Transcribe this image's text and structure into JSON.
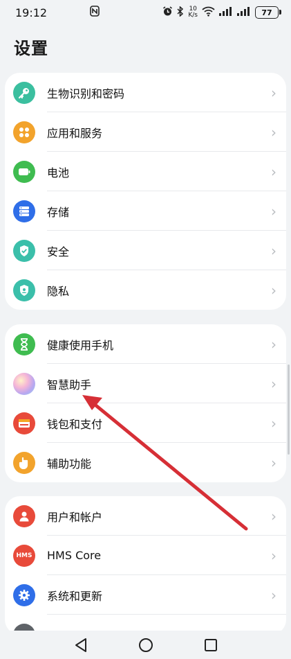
{
  "status_bar": {
    "time": "19:12",
    "speed_value": "10",
    "speed_unit": "K/s",
    "battery": "77"
  },
  "page": {
    "title": "设置"
  },
  "groups": [
    {
      "items": [
        {
          "label": "生物识别和密码",
          "icon": "key-icon",
          "color": "#3bbf9f"
        },
        {
          "label": "应用和服务",
          "icon": "apps-icon",
          "color": "#f2a32c"
        },
        {
          "label": "电池",
          "icon": "battery-icon",
          "color": "#3fbc50"
        },
        {
          "label": "存储",
          "icon": "storage-icon",
          "color": "#2f6ee8"
        },
        {
          "label": "安全",
          "icon": "shield-check-icon",
          "color": "#3bbfaa"
        },
        {
          "label": "隐私",
          "icon": "privacy-shield-icon",
          "color": "#3bbfaa"
        }
      ]
    },
    {
      "items": [
        {
          "label": "健康使用手机",
          "icon": "hourglass-icon",
          "color": "#3fbc50"
        },
        {
          "label": "智慧助手",
          "icon": "assistant-orb-icon",
          "color": "#c99be6"
        },
        {
          "label": "钱包和支付",
          "icon": "wallet-icon",
          "color": "#e84a3a"
        },
        {
          "label": "辅助功能",
          "icon": "hand-icon",
          "color": "#f2a32c"
        }
      ]
    },
    {
      "items": [
        {
          "label": "用户和帐户",
          "icon": "user-icon",
          "color": "#e84a3a"
        },
        {
          "label": "HMS Core",
          "icon": "hms-icon",
          "color": "#e84a3a",
          "icon_text": "HMS"
        },
        {
          "label": "系统和更新",
          "icon": "gear-icon",
          "color": "#2f6ee8"
        }
      ]
    }
  ],
  "nav": {
    "back": "back-icon",
    "home": "home-icon",
    "recents": "recents-icon"
  },
  "annotation": {
    "arrow_color": "#d62f36"
  }
}
